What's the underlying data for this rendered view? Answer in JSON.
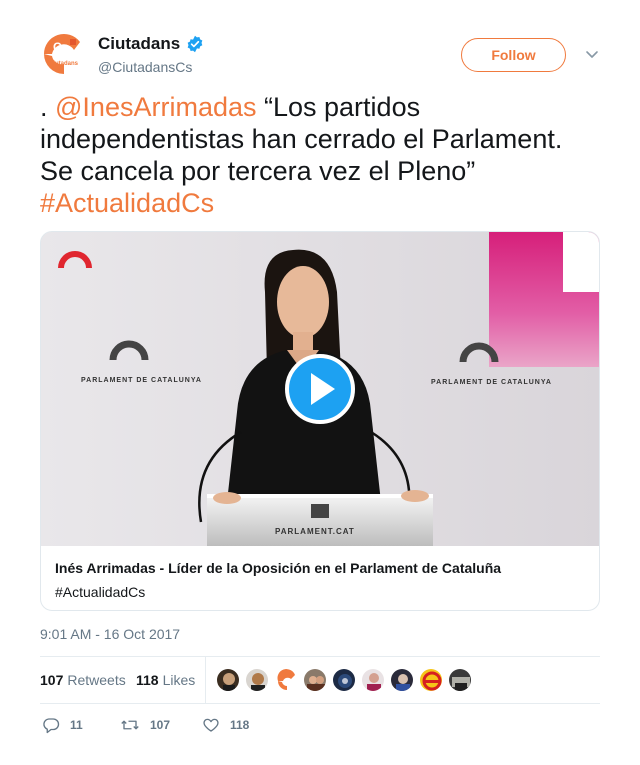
{
  "account": {
    "display_name": "Ciutadans",
    "handle": "@CiutadansCs",
    "verified": true,
    "avatar_text": "Cs",
    "avatar_subtext": "Ciutadans"
  },
  "follow_label": "Follow",
  "tweet": {
    "prefix": ". ",
    "mention": "@InesArrimadas",
    "quote": " “Los partidos independentistas han cerrado el Parlament. Se cancela por tercera vez el Pleno” ",
    "hashtag": "#ActualidadCs"
  },
  "card": {
    "title": "Inés Arrimadas - Líder de la Oposición en el Parlament de Cataluña",
    "description": "#ActualidadCs",
    "video_signs": [
      "PARLAMENT DE CATALUNYA",
      "PARLAMENT DE CATALUNYA",
      "PARLAMENT.CAT"
    ]
  },
  "timestamp": "9:01 AM - 16 Oct 2017",
  "stats": {
    "retweets_count": "107",
    "retweets_label": "Retweets",
    "likes_count": "118",
    "likes_label": "Likes"
  },
  "actions": {
    "reply_count": "11",
    "retweet_count": "107",
    "like_count": "118"
  },
  "colors": {
    "accent": "#f07a3e",
    "verified": "#1da1f2",
    "play_button": "#1da1f2",
    "muted_text": "#657786"
  },
  "icons": [
    "verified-badge-icon",
    "chevron-down-icon",
    "play-icon",
    "reply-icon",
    "retweet-icon",
    "heart-icon"
  ]
}
